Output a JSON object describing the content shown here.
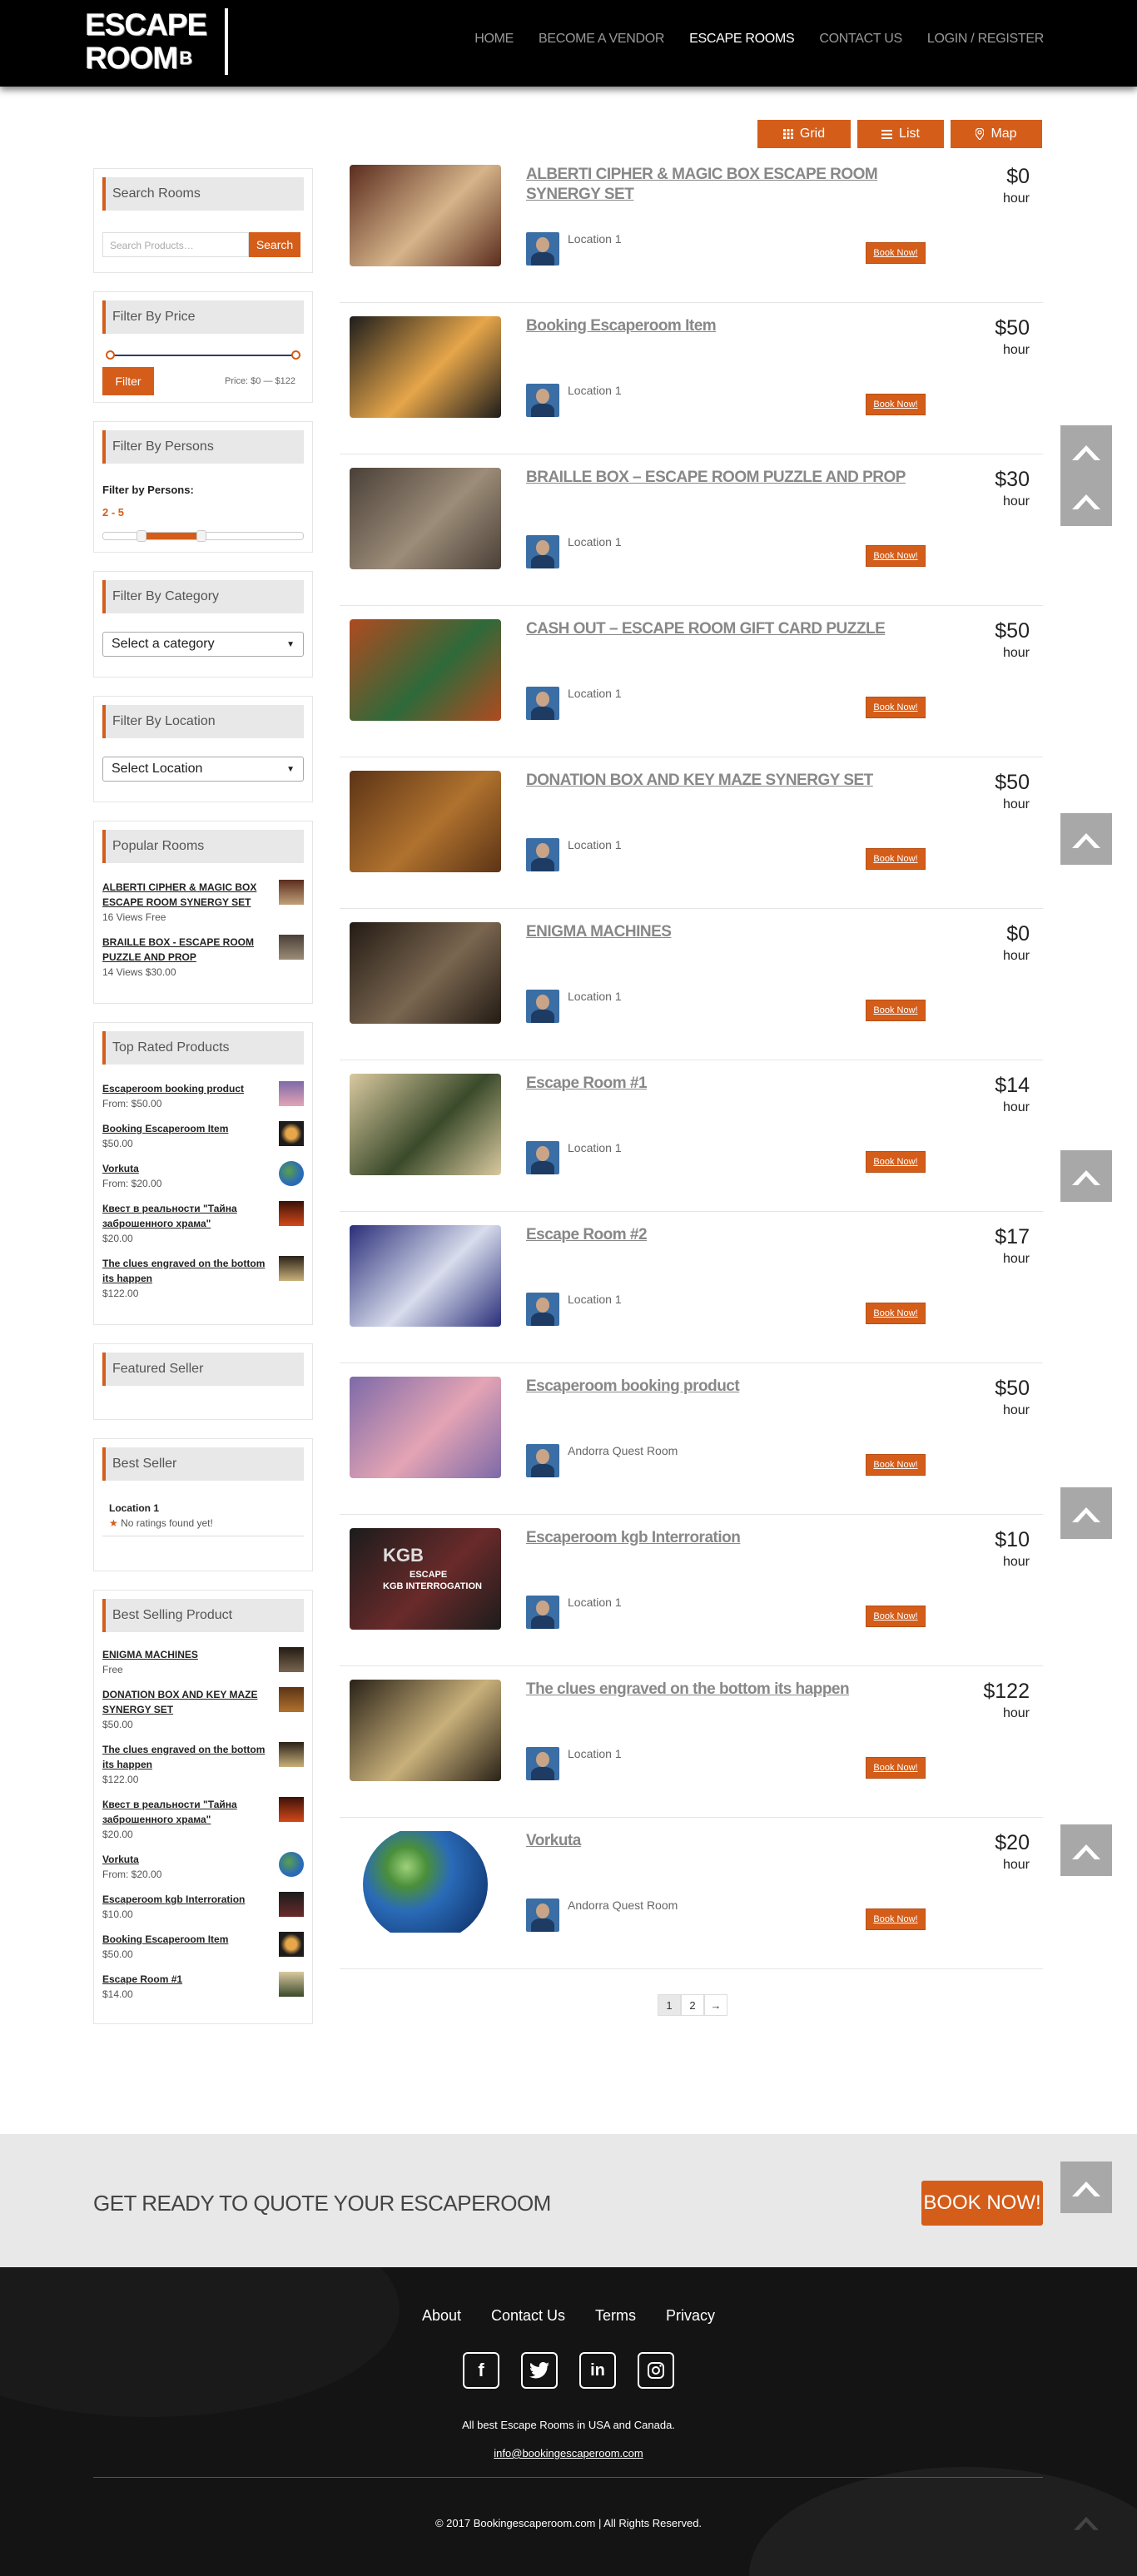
{
  "header": {
    "logo_line1": "ESCAPE",
    "logo_line2": "ROOM",
    "logo_suffix": "B",
    "nav": [
      "HOME",
      "BECOME A VENDOR",
      "ESCAPE ROOMS",
      "CONTACT US",
      "LOGIN / REGISTER"
    ],
    "active_nav": "ESCAPE ROOMS"
  },
  "view_buttons": {
    "grid": "Grid",
    "list": "List",
    "map": "Map"
  },
  "sidebar": {
    "search": {
      "title": "Search Rooms",
      "placeholder": "Search Products…",
      "button": "Search"
    },
    "price": {
      "title": "Filter By Price",
      "button": "Filter",
      "range_text": "Price: $0 — $122",
      "min": 0,
      "max": 122
    },
    "persons": {
      "title": "Filter By Persons",
      "label": "Filter by Persons:",
      "range": "2 - 5"
    },
    "category": {
      "title": "Filter By Category",
      "selected": "Select a category"
    },
    "location": {
      "title": "Filter By Location",
      "selected": "Select Location"
    },
    "popular": {
      "title": "Popular Rooms",
      "items": [
        {
          "name": "ALBERTI CIPHER & MAGIC BOX ESCAPE ROOM SYNERGY SET",
          "meta": "16 Views Free"
        },
        {
          "name": "BRAILLE BOX - ESCAPE ROOM PUZZLE AND PROP",
          "meta": "14 Views $30.00"
        }
      ]
    },
    "top_rated": {
      "title": "Top Rated Products",
      "items": [
        {
          "name": "Escaperoom booking product",
          "meta": "From: $50.00"
        },
        {
          "name": "Booking Escaperoom Item",
          "meta": "$50.00"
        },
        {
          "name": "Vorkuta",
          "meta": "From: $20.00"
        },
        {
          "name": "Квест в реальности \"Тайна заброшенного храма\"",
          "meta": "$20.00"
        },
        {
          "name": "The clues engraved on the bottom its happen",
          "meta": "$122.00"
        }
      ]
    },
    "featured_seller": {
      "title": "Featured Seller"
    },
    "best_seller": {
      "title": "Best Seller",
      "name": "Location 1",
      "rating": "No ratings found yet!"
    },
    "best_selling": {
      "title": "Best Selling Product",
      "items": [
        {
          "name": "ENIGMA MACHINES",
          "meta": "Free"
        },
        {
          "name": "DONATION BOX AND KEY MAZE SYNERGY SET",
          "meta": "$50.00"
        },
        {
          "name": "The clues engraved on the bottom its happen",
          "meta": "$122.00"
        },
        {
          "name": "Квест в реальности \"Тайна заброшенного храма\"",
          "meta": "$20.00"
        },
        {
          "name": "Vorkuta",
          "meta": "From: $20.00"
        },
        {
          "name": "Escaperoom kgb Interroration",
          "meta": "$10.00"
        },
        {
          "name": "Booking Escaperoom Item",
          "meta": "$50.00"
        },
        {
          "name": "Escape Room #1",
          "meta": "$14.00"
        }
      ]
    }
  },
  "products": [
    {
      "title": "ALBERTI CIPHER & MAGIC BOX ESCAPE ROOM SYNERGY SET",
      "vendor": "Location 1",
      "price": "$0",
      "unit": "hour",
      "book": "Book Now!",
      "c1": "#5a2c1e",
      "c2": "#d6b48a"
    },
    {
      "title": "Booking Escaperoom Item",
      "vendor": "Location 1",
      "price": "$50",
      "unit": "hour",
      "book": "Book Now!",
      "c1": "#1e1d1c",
      "c2": "#e6a64a"
    },
    {
      "title": "BRAILLE BOX – ESCAPE ROOM PUZZLE AND PROP",
      "vendor": "Location 1",
      "price": "$30",
      "unit": "hour",
      "book": "Book Now!",
      "c1": "#4a4038",
      "c2": "#9c8c78"
    },
    {
      "title": "CASH OUT – ESCAPE ROOM GIFT CARD PUZZLE",
      "vendor": "Location 1",
      "price": "$50",
      "unit": "hour",
      "book": "Book Now!",
      "c1": "#b04a20",
      "c2": "#2e6a3a"
    },
    {
      "title": "DONATION BOX AND KEY MAZE SYNERGY SET",
      "vendor": "Location 1",
      "price": "$50",
      "unit": "hour",
      "book": "Book Now!",
      "c1": "#5c3416",
      "c2": "#b0722e"
    },
    {
      "title": "ENIGMA MACHINES",
      "vendor": "Location 1",
      "price": "$0",
      "unit": "hour",
      "book": "Book Now!",
      "c1": "#231b14",
      "c2": "#7a6650"
    },
    {
      "title": "Escape Room #1",
      "vendor": "Location 1",
      "price": "$14",
      "unit": "hour",
      "book": "Book Now!",
      "c1": "#d9c9a0",
      "c2": "#3a4a2a"
    },
    {
      "title": "Escape Room #2",
      "vendor": "Location 1",
      "price": "$17",
      "unit": "hour",
      "book": "Book Now!",
      "c1": "#2a2f7a",
      "c2": "#d8dcec"
    },
    {
      "title": "Escaperoom booking product",
      "vendor": "Andorra Quest Room",
      "price": "$50",
      "unit": "hour",
      "book": "Book Now!",
      "c1": "#7d6aa8",
      "c2": "#e4a4b4"
    },
    {
      "title": "Escaperoom kgb Interroration",
      "vendor": "Location 1",
      "price": "$10",
      "unit": "hour",
      "book": "Book Now!",
      "c1": "#1c1c1c",
      "c2": "#6a2a2a",
      "overlay1": "KGB",
      "overlay2": "ESCAPE",
      "overlay3": "KGB INTERROGATION"
    },
    {
      "title": "The clues engraved on the bottom its happen",
      "vendor": "Location 1",
      "price": "$122",
      "unit": "hour",
      "book": "Book Now!",
      "c1": "#2a2218",
      "c2": "#c8b07a"
    },
    {
      "title": "Vorkuta",
      "vendor": "Andorra Quest Room",
      "price": "$20",
      "unit": "hour",
      "book": "Book Now!",
      "c1": "#ffffff",
      "c2": "#2a6bb8"
    }
  ],
  "pagination": {
    "pages": [
      "1",
      "2"
    ],
    "next": "→",
    "current": "1"
  },
  "quote": {
    "text": "GET READY TO QUOTE YOUR ESCAPEROOM",
    "button": "BOOK NOW!"
  },
  "footer": {
    "links": [
      "About",
      "Contact Us",
      "Terms",
      "Privacy"
    ],
    "social": [
      "facebook-icon",
      "twitter-icon",
      "linkedin-icon",
      "instagram-icon"
    ],
    "tagline": "All best Escape Rooms in USA and Canada.",
    "email": "info@bookingescaperoom.com",
    "copyright": "© 2017 Bookingescaperoom.com | All Rights Reserved."
  },
  "colors": {
    "accent": "#d45d1a",
    "header_bg": "#000000",
    "footer_bg": "#141414"
  }
}
